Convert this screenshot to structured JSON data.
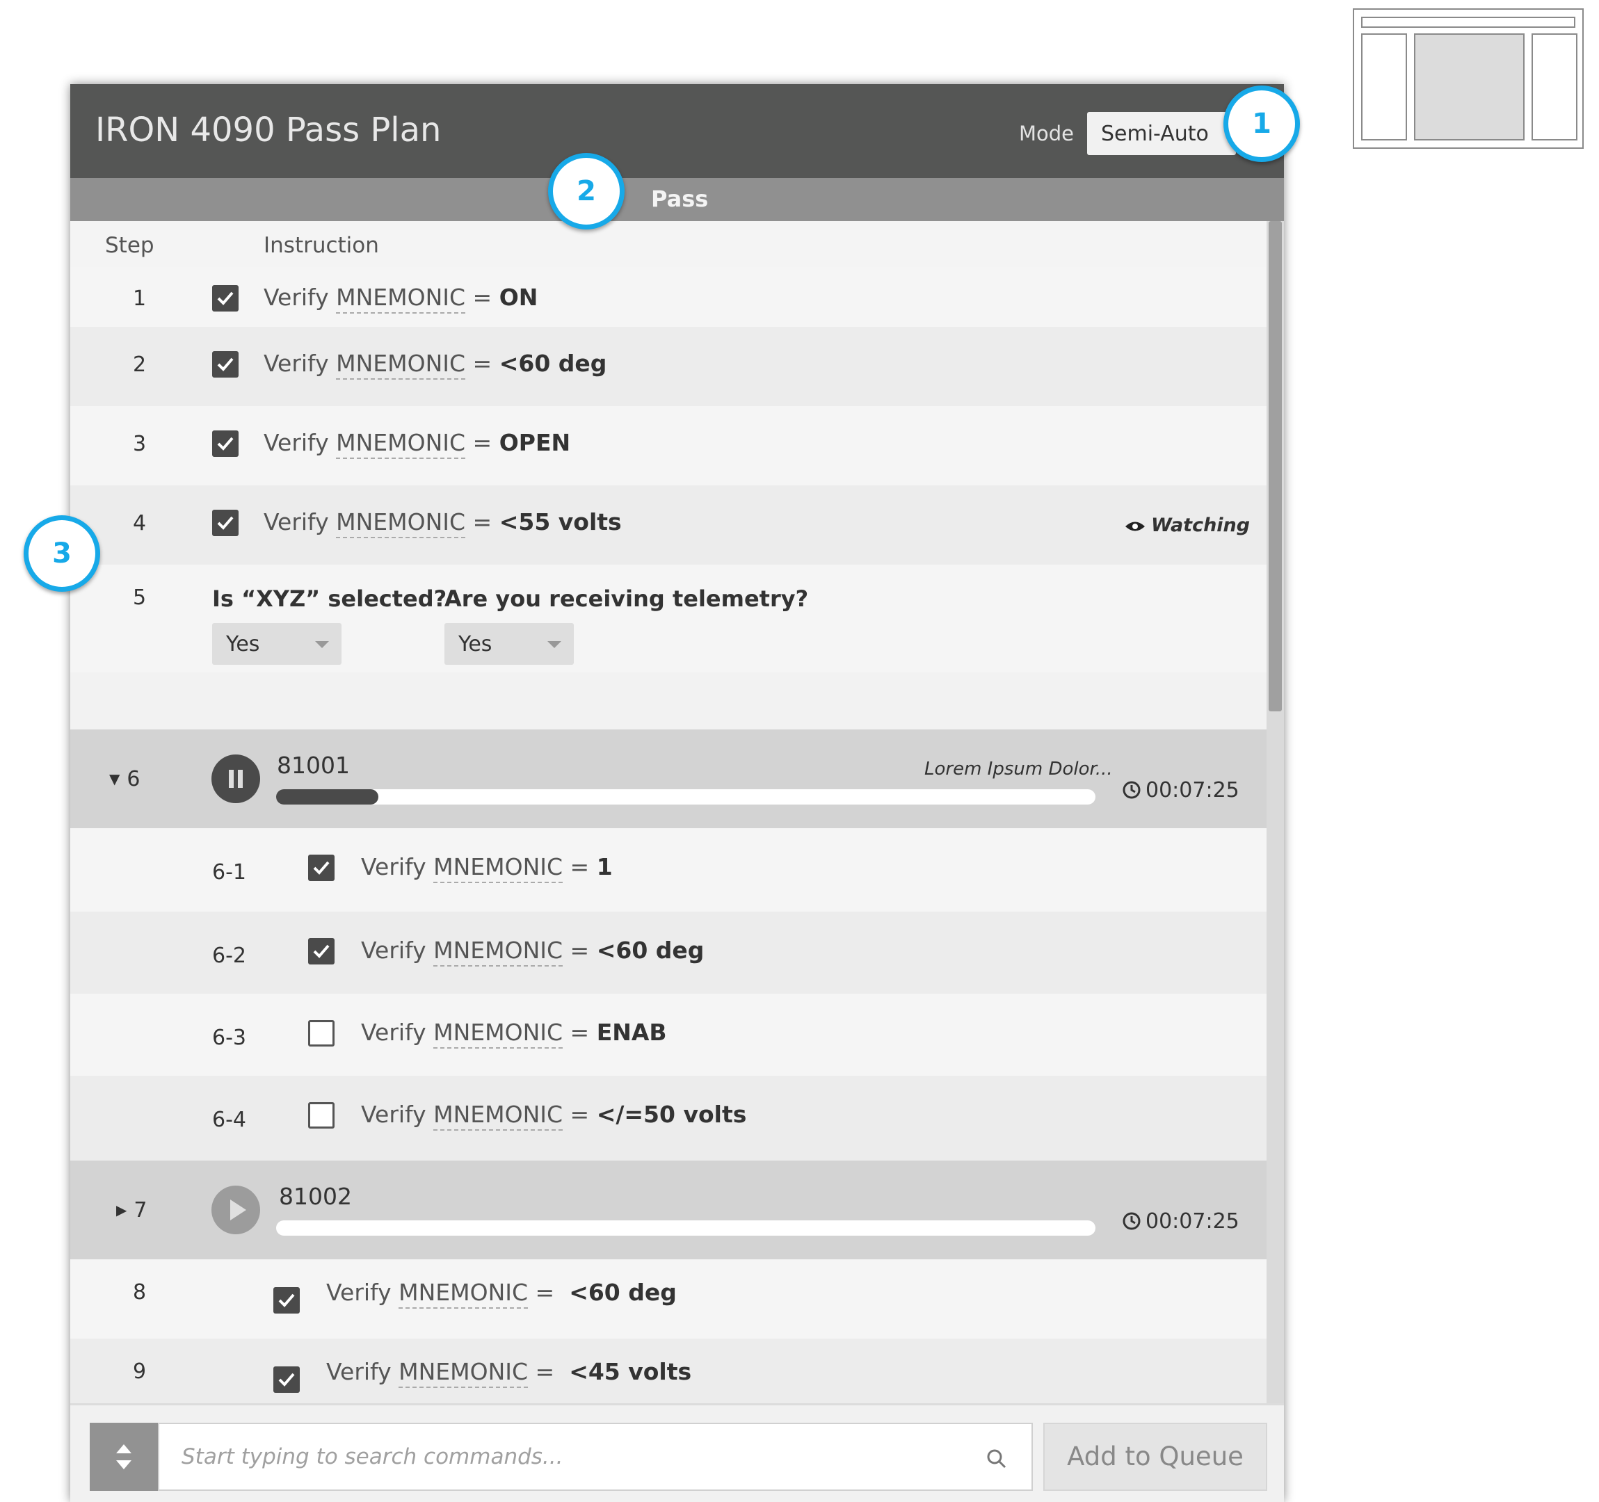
{
  "header": {
    "title": "IRON 4090 Pass Plan",
    "mode_label": "Mode",
    "mode_value": "Semi-Auto"
  },
  "pass_bar": {
    "label": "Pass"
  },
  "columns": {
    "step": "Step",
    "instruction": "Instruction"
  },
  "steps": [
    {
      "num": "1",
      "checked": true,
      "prefix": "Verify",
      "mnemonic": "MNEMONIC",
      "eq": "=",
      "value": "ON"
    },
    {
      "num": "2",
      "checked": true,
      "prefix": "Verify",
      "mnemonic": "MNEMONIC",
      "eq": "=",
      "value": "<60 deg"
    },
    {
      "num": "3",
      "checked": true,
      "prefix": "Verify",
      "mnemonic": "MNEMONIC",
      "eq": "=",
      "value": "OPEN"
    },
    {
      "num": "4",
      "checked": true,
      "prefix": "Verify",
      "mnemonic": "MNEMONIC",
      "eq": "=",
      "value": "<55 volts",
      "status": "Watching"
    }
  ],
  "step5": {
    "num": "5",
    "question1": "Is “XYZ” selected?",
    "answer1": "Yes",
    "question2": "Are you receiving telemetry?",
    "answer2": "Yes"
  },
  "step6": {
    "num": "6",
    "code": "81001",
    "description": "Lorem Ipsum Dolor...",
    "timer": "00:07:25",
    "progress": 0.125,
    "state": "paused",
    "expanded": true
  },
  "substeps": [
    {
      "num": "6-1",
      "checked": true,
      "prefix": "Verify",
      "mnemonic": "MNEMONIC",
      "eq": "=",
      "value": "1"
    },
    {
      "num": "6-2",
      "checked": true,
      "prefix": "Verify",
      "mnemonic": "MNEMONIC",
      "eq": "=",
      "value": "<60 deg"
    },
    {
      "num": "6-3",
      "checked": false,
      "prefix": "Verify",
      "mnemonic": "MNEMONIC",
      "eq": "=",
      "value": "ENAB"
    },
    {
      "num": "6-4",
      "checked": false,
      "prefix": "Verify",
      "mnemonic": "MNEMONIC",
      "eq": "=",
      "value": "</=50 volts"
    }
  ],
  "step7": {
    "num": "7",
    "code": "81002",
    "timer": "00:07:25",
    "progress": 0,
    "state": "stopped",
    "expanded": false
  },
  "later_steps": [
    {
      "num": "8",
      "checked": true,
      "prefix": "Verify",
      "mnemonic": "MNEMONIC",
      "eq": "=",
      "value": "<60 deg"
    },
    {
      "num": "9",
      "checked": true,
      "prefix": "Verify",
      "mnemonic": "MNEMONIC",
      "eq": "=",
      "value": "<45 volts"
    }
  ],
  "footer": {
    "search_placeholder": "Start typing to search commands...",
    "add_button": "Add to Queue"
  },
  "callouts": [
    "1",
    "2",
    "3"
  ],
  "colors": {
    "header_bg": "#555655",
    "accent_callout": "#17a9e8",
    "pass_bar": "#909090"
  }
}
